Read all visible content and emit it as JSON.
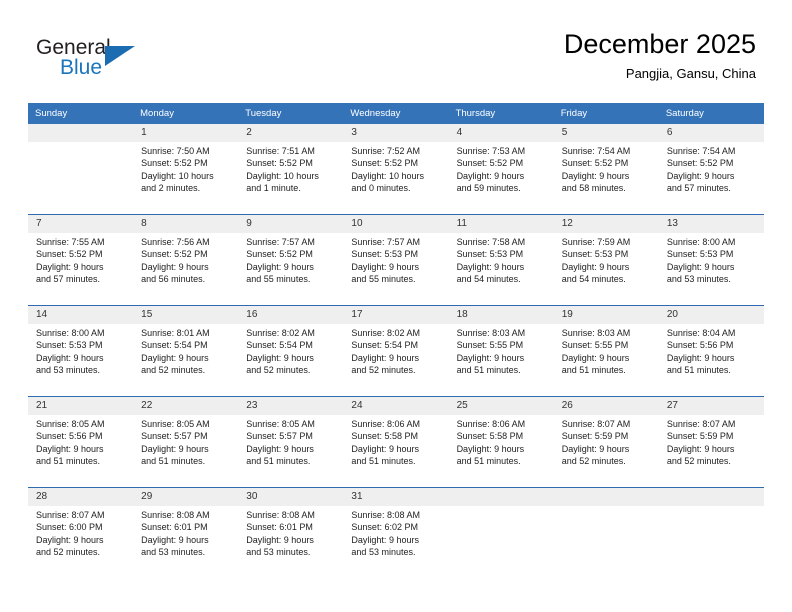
{
  "brand": {
    "name_top": "General",
    "name_bottom": "Blue",
    "accent_color": "#1b6cb0"
  },
  "header": {
    "title": "December 2025",
    "subtitle": "Pangjia, Gansu, China"
  },
  "calendar": {
    "header_bg": "#3573b9",
    "daynum_bg": "#efefef",
    "row_divider": "#2f6bb0",
    "weekday_headers": [
      "Sunday",
      "Monday",
      "Tuesday",
      "Wednesday",
      "Thursday",
      "Friday",
      "Saturday"
    ],
    "weeks": [
      [
        {
          "day": "",
          "sunrise": "",
          "sunset": "",
          "daylight_1": "",
          "daylight_2": ""
        },
        {
          "day": "1",
          "sunrise": "Sunrise: 7:50 AM",
          "sunset": "Sunset: 5:52 PM",
          "daylight_1": "Daylight: 10 hours",
          "daylight_2": "and 2 minutes."
        },
        {
          "day": "2",
          "sunrise": "Sunrise: 7:51 AM",
          "sunset": "Sunset: 5:52 PM",
          "daylight_1": "Daylight: 10 hours",
          "daylight_2": "and 1 minute."
        },
        {
          "day": "3",
          "sunrise": "Sunrise: 7:52 AM",
          "sunset": "Sunset: 5:52 PM",
          "daylight_1": "Daylight: 10 hours",
          "daylight_2": "and 0 minutes."
        },
        {
          "day": "4",
          "sunrise": "Sunrise: 7:53 AM",
          "sunset": "Sunset: 5:52 PM",
          "daylight_1": "Daylight: 9 hours",
          "daylight_2": "and 59 minutes."
        },
        {
          "day": "5",
          "sunrise": "Sunrise: 7:54 AM",
          "sunset": "Sunset: 5:52 PM",
          "daylight_1": "Daylight: 9 hours",
          "daylight_2": "and 58 minutes."
        },
        {
          "day": "6",
          "sunrise": "Sunrise: 7:54 AM",
          "sunset": "Sunset: 5:52 PM",
          "daylight_1": "Daylight: 9 hours",
          "daylight_2": "and 57 minutes."
        }
      ],
      [
        {
          "day": "7",
          "sunrise": "Sunrise: 7:55 AM",
          "sunset": "Sunset: 5:52 PM",
          "daylight_1": "Daylight: 9 hours",
          "daylight_2": "and 57 minutes."
        },
        {
          "day": "8",
          "sunrise": "Sunrise: 7:56 AM",
          "sunset": "Sunset: 5:52 PM",
          "daylight_1": "Daylight: 9 hours",
          "daylight_2": "and 56 minutes."
        },
        {
          "day": "9",
          "sunrise": "Sunrise: 7:57 AM",
          "sunset": "Sunset: 5:52 PM",
          "daylight_1": "Daylight: 9 hours",
          "daylight_2": "and 55 minutes."
        },
        {
          "day": "10",
          "sunrise": "Sunrise: 7:57 AM",
          "sunset": "Sunset: 5:53 PM",
          "daylight_1": "Daylight: 9 hours",
          "daylight_2": "and 55 minutes."
        },
        {
          "day": "11",
          "sunrise": "Sunrise: 7:58 AM",
          "sunset": "Sunset: 5:53 PM",
          "daylight_1": "Daylight: 9 hours",
          "daylight_2": "and 54 minutes."
        },
        {
          "day": "12",
          "sunrise": "Sunrise: 7:59 AM",
          "sunset": "Sunset: 5:53 PM",
          "daylight_1": "Daylight: 9 hours",
          "daylight_2": "and 54 minutes."
        },
        {
          "day": "13",
          "sunrise": "Sunrise: 8:00 AM",
          "sunset": "Sunset: 5:53 PM",
          "daylight_1": "Daylight: 9 hours",
          "daylight_2": "and 53 minutes."
        }
      ],
      [
        {
          "day": "14",
          "sunrise": "Sunrise: 8:00 AM",
          "sunset": "Sunset: 5:53 PM",
          "daylight_1": "Daylight: 9 hours",
          "daylight_2": "and 53 minutes."
        },
        {
          "day": "15",
          "sunrise": "Sunrise: 8:01 AM",
          "sunset": "Sunset: 5:54 PM",
          "daylight_1": "Daylight: 9 hours",
          "daylight_2": "and 52 minutes."
        },
        {
          "day": "16",
          "sunrise": "Sunrise: 8:02 AM",
          "sunset": "Sunset: 5:54 PM",
          "daylight_1": "Daylight: 9 hours",
          "daylight_2": "and 52 minutes."
        },
        {
          "day": "17",
          "sunrise": "Sunrise: 8:02 AM",
          "sunset": "Sunset: 5:54 PM",
          "daylight_1": "Daylight: 9 hours",
          "daylight_2": "and 52 minutes."
        },
        {
          "day": "18",
          "sunrise": "Sunrise: 8:03 AM",
          "sunset": "Sunset: 5:55 PM",
          "daylight_1": "Daylight: 9 hours",
          "daylight_2": "and 51 minutes."
        },
        {
          "day": "19",
          "sunrise": "Sunrise: 8:03 AM",
          "sunset": "Sunset: 5:55 PM",
          "daylight_1": "Daylight: 9 hours",
          "daylight_2": "and 51 minutes."
        },
        {
          "day": "20",
          "sunrise": "Sunrise: 8:04 AM",
          "sunset": "Sunset: 5:56 PM",
          "daylight_1": "Daylight: 9 hours",
          "daylight_2": "and 51 minutes."
        }
      ],
      [
        {
          "day": "21",
          "sunrise": "Sunrise: 8:05 AM",
          "sunset": "Sunset: 5:56 PM",
          "daylight_1": "Daylight: 9 hours",
          "daylight_2": "and 51 minutes."
        },
        {
          "day": "22",
          "sunrise": "Sunrise: 8:05 AM",
          "sunset": "Sunset: 5:57 PM",
          "daylight_1": "Daylight: 9 hours",
          "daylight_2": "and 51 minutes."
        },
        {
          "day": "23",
          "sunrise": "Sunrise: 8:05 AM",
          "sunset": "Sunset: 5:57 PM",
          "daylight_1": "Daylight: 9 hours",
          "daylight_2": "and 51 minutes."
        },
        {
          "day": "24",
          "sunrise": "Sunrise: 8:06 AM",
          "sunset": "Sunset: 5:58 PM",
          "daylight_1": "Daylight: 9 hours",
          "daylight_2": "and 51 minutes."
        },
        {
          "day": "25",
          "sunrise": "Sunrise: 8:06 AM",
          "sunset": "Sunset: 5:58 PM",
          "daylight_1": "Daylight: 9 hours",
          "daylight_2": "and 51 minutes."
        },
        {
          "day": "26",
          "sunrise": "Sunrise: 8:07 AM",
          "sunset": "Sunset: 5:59 PM",
          "daylight_1": "Daylight: 9 hours",
          "daylight_2": "and 52 minutes."
        },
        {
          "day": "27",
          "sunrise": "Sunrise: 8:07 AM",
          "sunset": "Sunset: 5:59 PM",
          "daylight_1": "Daylight: 9 hours",
          "daylight_2": "and 52 minutes."
        }
      ],
      [
        {
          "day": "28",
          "sunrise": "Sunrise: 8:07 AM",
          "sunset": "Sunset: 6:00 PM",
          "daylight_1": "Daylight: 9 hours",
          "daylight_2": "and 52 minutes."
        },
        {
          "day": "29",
          "sunrise": "Sunrise: 8:08 AM",
          "sunset": "Sunset: 6:01 PM",
          "daylight_1": "Daylight: 9 hours",
          "daylight_2": "and 53 minutes."
        },
        {
          "day": "30",
          "sunrise": "Sunrise: 8:08 AM",
          "sunset": "Sunset: 6:01 PM",
          "daylight_1": "Daylight: 9 hours",
          "daylight_2": "and 53 minutes."
        },
        {
          "day": "31",
          "sunrise": "Sunrise: 8:08 AM",
          "sunset": "Sunset: 6:02 PM",
          "daylight_1": "Daylight: 9 hours",
          "daylight_2": "and 53 minutes."
        },
        {
          "day": "",
          "sunrise": "",
          "sunset": "",
          "daylight_1": "",
          "daylight_2": ""
        },
        {
          "day": "",
          "sunrise": "",
          "sunset": "",
          "daylight_1": "",
          "daylight_2": ""
        },
        {
          "day": "",
          "sunrise": "",
          "sunset": "",
          "daylight_1": "",
          "daylight_2": ""
        }
      ]
    ]
  }
}
